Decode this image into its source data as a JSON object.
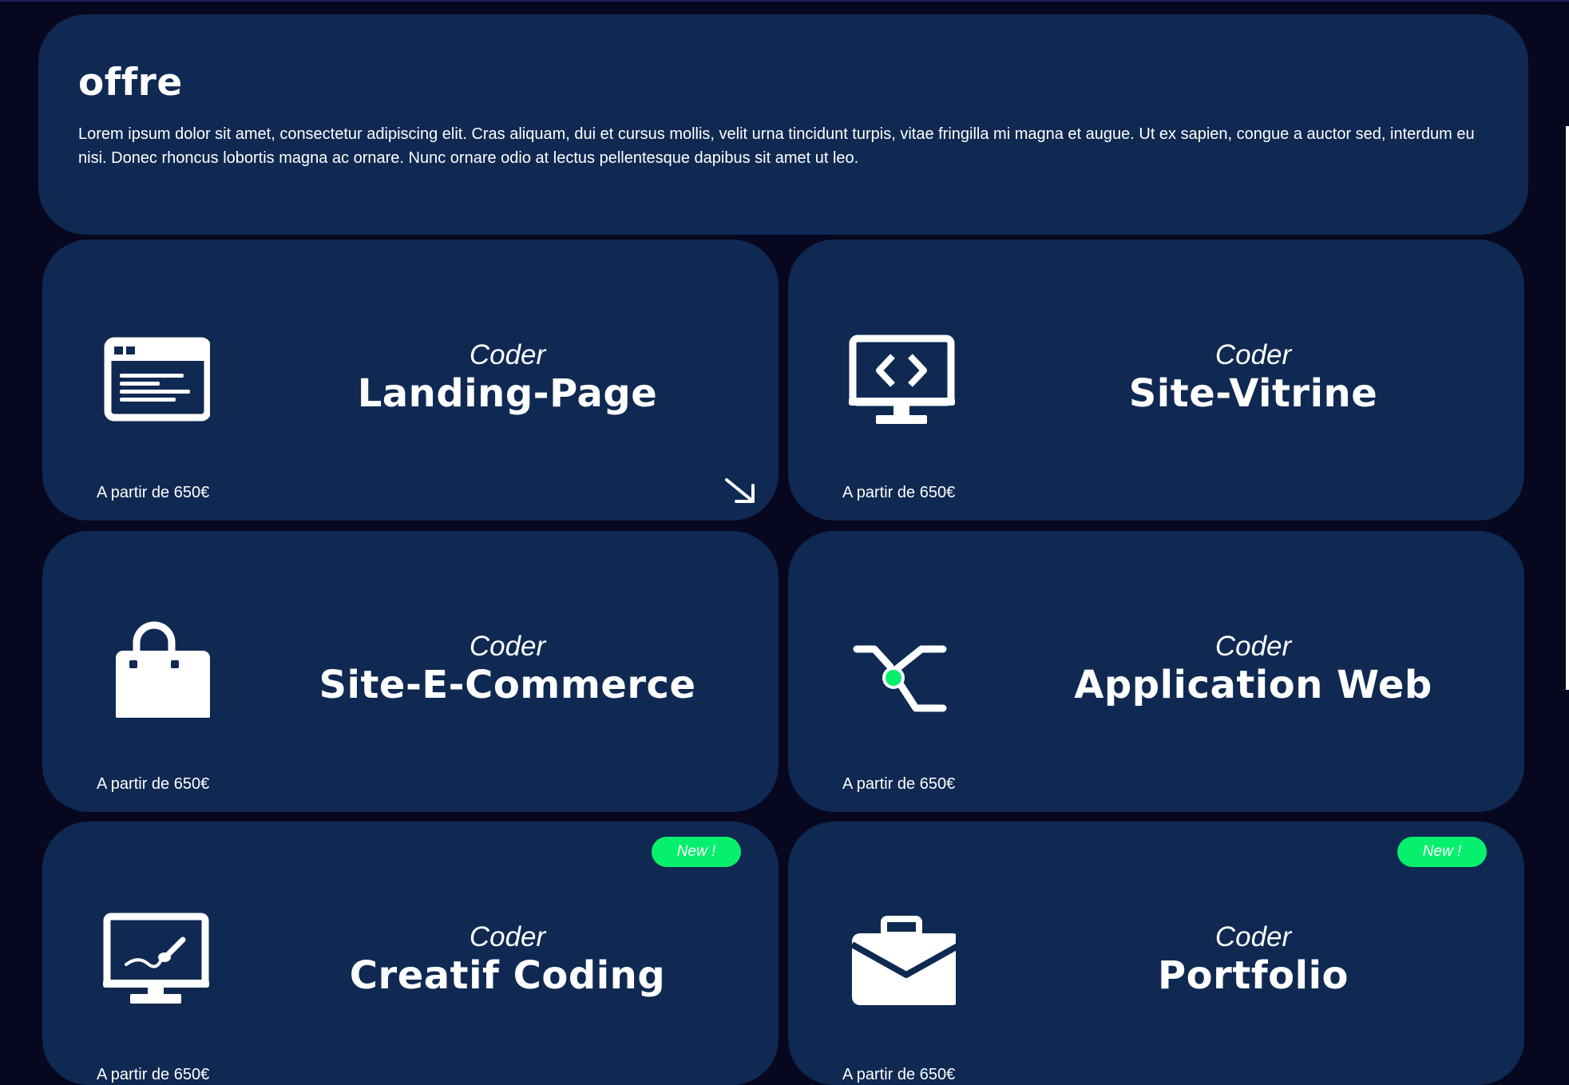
{
  "intro": {
    "title": "offre",
    "text": "Lorem ipsum dolor sit amet, consectetur adipiscing elit. Cras aliquam, dui et cursus mollis, velit urna tincidunt turpis, vitae fringilla mi magna et augue. Ut ex sapien, congue a auctor sed, interdum eu nisi. Donec rhoncus lobortis magna ac ornare. Nunc ornare odio at lectus pellentesque dapibus sit amet ut leo."
  },
  "cards": [
    {
      "icon": "browser-window-icon",
      "prefix": "Coder",
      "title": "Landing-Page",
      "price": "A partir de 650€",
      "arrow": "arrow-down-right-icon"
    },
    {
      "icon": "code-monitor-icon",
      "prefix": "Coder",
      "title": "Site-Vitrine",
      "price": "A partir de 650€"
    },
    {
      "icon": "shopping-bag-icon",
      "prefix": "Coder",
      "title": "Site-E-Commerce",
      "price": "A partir de 650€"
    },
    {
      "icon": "branch-node-icon",
      "prefix": "Coder",
      "title": "Application Web",
      "price": "A partir de 650€"
    },
    {
      "icon": "paint-monitor-icon",
      "prefix": "Coder",
      "title": "Creatif Coding",
      "price": "A partir de 650€",
      "badge": "New !"
    },
    {
      "icon": "briefcase-icon",
      "prefix": "Coder",
      "title": "Portfolio",
      "price": "A partir de 650€",
      "badge": "New !"
    }
  ],
  "colors": {
    "background": "#07071f",
    "card": "#0f2952",
    "badge": "#07f06d",
    "accent_dot": "#07f06d",
    "text": "#ffffff"
  }
}
